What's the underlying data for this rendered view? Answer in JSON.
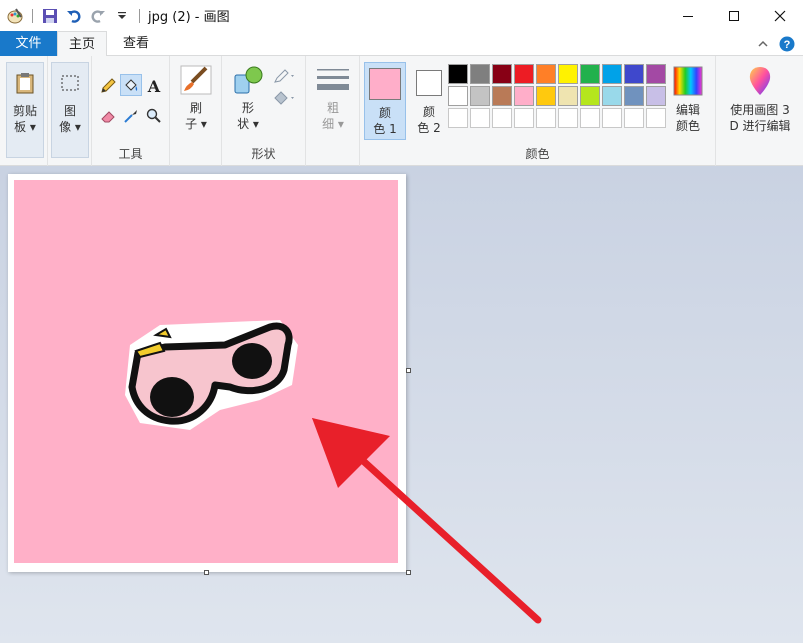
{
  "window": {
    "title": "jpg (2) - 画图",
    "minimize_label": "—",
    "maximize_label": "☐",
    "close_label": "✕"
  },
  "tabs": {
    "file": "文件",
    "home": "主页",
    "view": "查看"
  },
  "ribbon": {
    "clipboard": {
      "line1": "剪贴",
      "line2": "板"
    },
    "image": {
      "line1": "图",
      "line2": "像"
    },
    "tools": {
      "label": "工具"
    },
    "brushes": {
      "line1": "刷",
      "line2": "子"
    },
    "shapes": {
      "line1": "形",
      "line2": "状",
      "label": "形状"
    },
    "size": {
      "line1": "粗",
      "line2": "细"
    },
    "color1": {
      "line1": "颜",
      "line2": "色 1"
    },
    "color2": {
      "line1": "颜",
      "line2": "色 2"
    },
    "colors_label": "颜色",
    "edit_colors": {
      "line1": "编辑",
      "line2": "颜色"
    },
    "paint3d": {
      "line1": "使用画图 3",
      "line2": "D 进行编辑"
    }
  },
  "palette": {
    "row1": [
      "#000000",
      "#7f7f7f",
      "#880015",
      "#ed1c24",
      "#ff7f27",
      "#fff200",
      "#22b14c",
      "#00a2e8",
      "#3f48cc",
      "#a349a4"
    ],
    "row2": [
      "#ffffff",
      "#c3c3c3",
      "#b97a57",
      "#ffaec9",
      "#ffc90e",
      "#efe4b0",
      "#b5e61d",
      "#99d9ea",
      "#7092be",
      "#c8bfe7"
    ]
  },
  "colors": {
    "color1": "#ffaec9",
    "color2": "#ffffff",
    "canvas_pink": "#ffb0c8",
    "accent": "#1979ca",
    "arrow": "#e8202a"
  }
}
